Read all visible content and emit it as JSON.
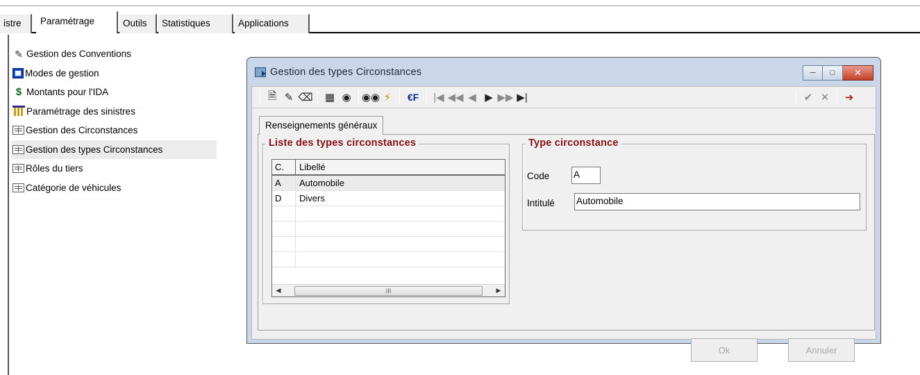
{
  "tabs": [
    {
      "label": "istre",
      "active": false
    },
    {
      "label": "Paramétrage",
      "active": true
    },
    {
      "label": "Outils",
      "active": false
    },
    {
      "label": "Statistiques",
      "active": false
    },
    {
      "label": "Applications",
      "active": false
    }
  ],
  "tree": {
    "items": [
      {
        "label": "Gestion des Conventions",
        "icon": "handshake-icon"
      },
      {
        "label": "Modes de gestion",
        "icon": "floppy-icon"
      },
      {
        "label": "Montants pour l'IDA",
        "icon": "dollar-icon"
      },
      {
        "label": "Paramétrage des sinistres",
        "icon": "pillar-icon"
      },
      {
        "label": "Gestion des Circonstances",
        "icon": "list-icon"
      },
      {
        "label": "Gestion des types Circonstances",
        "icon": "list-icon",
        "selected": true
      },
      {
        "label": "Rôles du tiers",
        "icon": "list-icon"
      },
      {
        "label": "Catégorie de véhicules",
        "icon": "list-icon"
      }
    ]
  },
  "dialog": {
    "title": "Gestion des types Circonstances",
    "tab_label": "Renseignements généraux",
    "list_group": {
      "title": "Liste des types circonstances",
      "columns": [
        "C.",
        "Libellé"
      ],
      "rows": [
        {
          "code": "A",
          "label": "Automobile",
          "selected": true
        },
        {
          "code": "D",
          "label": "Divers",
          "selected": false
        }
      ],
      "scroll_thumb": "III"
    },
    "detail_group": {
      "title": "Type circonstance",
      "code_label": "Code",
      "code_value": "A",
      "intitule_label": "Intitulé",
      "intitule_value": "Automobile"
    },
    "ok_label": "Ok",
    "cancel_label": "Annuler",
    "euro_label": "€F"
  },
  "colors": {
    "group_title": "#8a0f14",
    "dialog_frame": "#c9d7e8",
    "client_bg": "#f0f0f0"
  }
}
